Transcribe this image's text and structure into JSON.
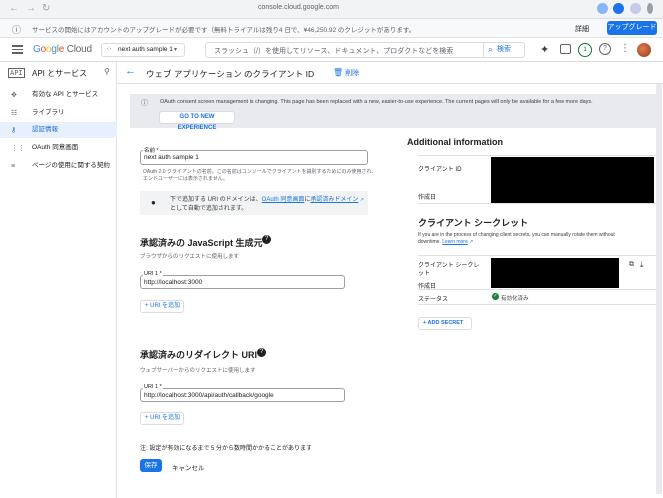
{
  "browser": {
    "url": "console.cloud.google.com"
  },
  "trial": {
    "message": "サービスの開始にはアカウントのアップグレードが必要です（無料トライアルは残り4 日で、¥46,250.92 のクレジットがあります。",
    "details_label": "詳細",
    "upgrade_label": "アップグレード"
  },
  "header": {
    "logo": "Google Cloud",
    "project": "next auth sample 1",
    "search_placeholder": "スラッシュ（/）を使用してリソース、ドキュメント、プロダクトなどを検索",
    "search_button": "検索",
    "notification_count": "1"
  },
  "sidebar": {
    "api_badge": "API",
    "title": "API とサービス",
    "items": [
      {
        "label": "有効な API とサービス",
        "icon": "diamond-icon"
      },
      {
        "label": "ライブラリ",
        "icon": "library-icon"
      },
      {
        "label": "認証情報",
        "icon": "key-icon"
      },
      {
        "label": "OAuth 同意画面",
        "icon": "consent-icon"
      },
      {
        "label": "ページの使用に関する契約",
        "icon": "settings-icon"
      }
    ]
  },
  "page": {
    "title": "ウェブ アプリケーション のクライアント ID",
    "delete_label": "削除"
  },
  "notice": {
    "text": "OAuth consent screen management is changing. This page has been replaced with a new, easier-to-use experience. The current pages will only be available for a few more days.",
    "button": "GO TO NEW EXPERIENCE"
  },
  "form": {
    "name_label": "名前 *",
    "name_value": "next auth sample 1",
    "name_helper_1": "OAuth 2.0 クライアントの名前。この名前はコンソールでクライアントを識別するためにのみ使用され、",
    "name_helper_2": "エンドユーザーには表示されません。",
    "domain_info_1": "下で追加する URI のドメインは、",
    "domain_info_link": "OAuth 同意画面",
    "domain_info_2": "に",
    "domain_info_link2": "承認済みドメイン",
    "domain_info_3": "として自動で追加されます。",
    "js_title": "承認済みの JavaScript 生成元",
    "js_sub": "ブラウザからのリクエストに使用します",
    "js_uri_label": "URI 1 *",
    "js_uri_value": "http://localhost:3000",
    "add_uri": "+ URI を追加",
    "redirect_title": "承認済みのリダイレクト URI",
    "redirect_sub": "ウェブサーバーからのリクエストに使用します",
    "redirect_uri_label": "URI 1 *",
    "redirect_uri_value": "http://localhost:3000/api/auth/callback/google",
    "note": "注: 設定が有効になるまで 5 分から数時間かかることがあります",
    "save": "保存",
    "cancel": "キャンセル"
  },
  "info": {
    "title": "Additional information",
    "client_id_label": "クライアント ID",
    "created_label": "作成日",
    "secret_title": "クライアント シークレット",
    "secret_desc_1": "If you are in the process of changing client secrets, you can manually rotate them without",
    "secret_desc_2": "downtime. ",
    "learn_more": "Learn more",
    "secret_label_1": "クライアント シークレ",
    "secret_label_2": "ット",
    "secret_created": "作成日",
    "status_label": "ステータス",
    "status_value": "有効化済み",
    "add_secret": "+ ADD SECRET"
  }
}
